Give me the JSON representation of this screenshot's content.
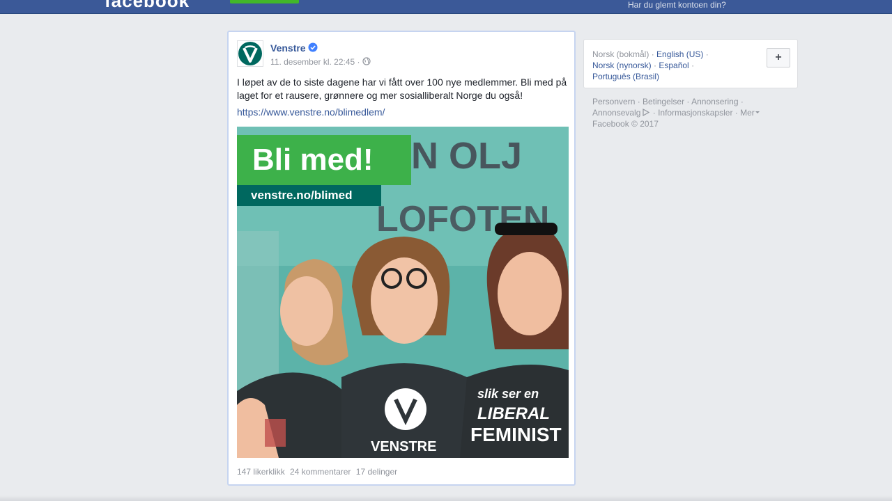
{
  "header": {
    "logo_text": "facebook",
    "forgot_account": "Har du glemt kontoen din?"
  },
  "post": {
    "page_name": "Venstre",
    "timestamp": "11. desember kl. 22:45 ·",
    "text": "I løpet av de to siste dagene har vi fått over 100 nye medlemmer. Bli med på laget for et rausere, grønnere og mer sosialliberalt Norge du også!",
    "link": "https://www.venstre.no/blimedlem/",
    "image": {
      "headline": "Bli med!",
      "url_banner": "venstre.no/blimed",
      "shirt_logo_text": "VENSTRE",
      "shirt_text_line1": "slik ser en",
      "shirt_text_line2": "LIBERAL",
      "shirt_text_line3": "FEMINIST",
      "background_text_1": "LOFOTEN",
      "background_text_2": "N OLJ"
    },
    "likes": "147 likerklikk",
    "comments": "24 kommentarer",
    "shares": "17 delinger"
  },
  "languages": {
    "current": "Norsk (bokmål)",
    "options": [
      "English (US)",
      "Norsk (nynorsk)",
      "Español",
      "Português (Brasil)"
    ],
    "add_label": "+"
  },
  "footer": {
    "links": [
      "Personvern",
      "Betingelser",
      "Annonsering",
      "Annonsevalg",
      "Informasjonskapsler",
      "Mer"
    ],
    "copyright": "Facebook © 2017"
  },
  "colors": {
    "topbar": "#3b5998",
    "link": "#365899",
    "signup_green": "#42b72a",
    "venstre_green": "#00685f",
    "banner_green": "#3db14a"
  },
  "icons": {
    "verified": "verified-badge-icon",
    "audience": "globe-icon",
    "adchoices": "adchoices-icon",
    "more": "caret-down-icon"
  }
}
